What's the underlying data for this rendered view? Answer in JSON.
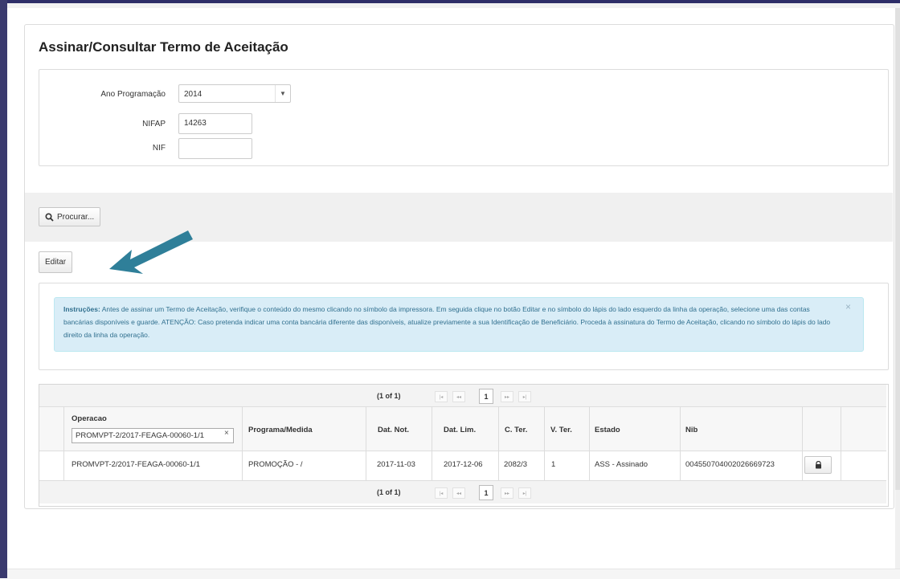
{
  "page": {
    "title": "Assinar/Consultar Termo de Aceitação"
  },
  "form": {
    "ano_label": "Ano Programação",
    "ano_value": "2014",
    "nifap_label": "NIFAP",
    "nifap_value": "14263",
    "nif_label": "NIF",
    "nif_value": ""
  },
  "buttons": {
    "search": "Procurar...",
    "edit": "Editar"
  },
  "instructions": {
    "title": "Instruções:",
    "text": "Antes de assinar um Termo de Aceitação, verifique o conteúdo do mesmo clicando no símbolo da impressora. Em seguida clique no botão Editar e no símbolo do lápis do lado esquerdo da linha da operação, selecione uma das contas bancárias disponíveis e guarde. ATENÇÃO: Caso pretenda indicar uma conta bancária diferente das disponíveis, atualize previamente a sua Identificação de Beneficiário. Proceda à assinatura do Termo de Aceitação, clicando no símbolo do lápis do lado direito da linha da operação.",
    "close_glyph": "×"
  },
  "paginator": {
    "report": "(1 of 1)",
    "current_page": "1",
    "first": "|◂",
    "prev": "◂◂",
    "next": "▸▸",
    "last": "▸|"
  },
  "table": {
    "columns": [
      "Operacao",
      "Programa/Medida",
      "Dat. Not.",
      "Dat. Lim.",
      "C. Ter.",
      "V. Ter.",
      "Estado",
      "Nib"
    ],
    "filter_value": "PROMVPT-2/2017-FEAGA-00060-1/1",
    "filter_clear": "×",
    "rows": [
      {
        "operacao": "PROMVPT-2/2017-FEAGA-00060-1/1",
        "programa": "PROMOÇÃO - /",
        "dat_not": "2017-11-03",
        "dat_lim": "2017-12-06",
        "c_ter": "2082/3",
        "v_ter": "1",
        "estado": "ASS - Assinado",
        "nib": "004550704002026669723"
      }
    ]
  },
  "colors": {
    "arrow": "#2f7f99",
    "alert_bg": "#d9edf7",
    "alert_text": "#31708f"
  },
  "icons": {
    "search": "magnifier-icon",
    "lock": "lock-icon",
    "arrow": "arrow-annotation-icon"
  }
}
